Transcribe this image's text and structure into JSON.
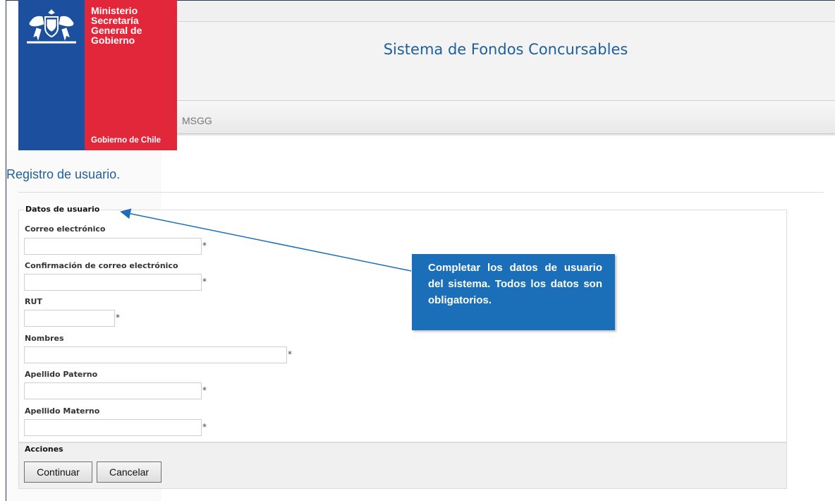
{
  "logo": {
    "line1": "Ministerio",
    "line2": "Secretaría",
    "line3": "General de",
    "line4": "Gobierno",
    "footer": "Gobierno de Chile",
    "colors": {
      "blue": "#1d4f9f",
      "red": "#e3273b"
    }
  },
  "header": {
    "title": "Sistema de Fondos Concursables",
    "title_color": "#1f5f99"
  },
  "nav": {
    "items": [
      "MSGG"
    ]
  },
  "page": {
    "heading": "Registro de usuario."
  },
  "form": {
    "legend": "Datos de usuario",
    "required_mark": "*",
    "fields": [
      {
        "label": "Correo electrónico",
        "value": ""
      },
      {
        "label": "Confirmación de correo electrónico",
        "value": ""
      },
      {
        "label": "RUT",
        "value": ""
      },
      {
        "label": "Nombres",
        "value": ""
      },
      {
        "label": "Apellido Paterno",
        "value": ""
      },
      {
        "label": "Apellido Materno",
        "value": ""
      }
    ]
  },
  "actions": {
    "label": "Acciones",
    "continue_label": "Continuar",
    "cancel_label": "Cancelar"
  },
  "callout": {
    "text": "Completar los datos de usuario del sistema. Todos los datos son obligatorios.",
    "color": "#1a6fb8"
  }
}
